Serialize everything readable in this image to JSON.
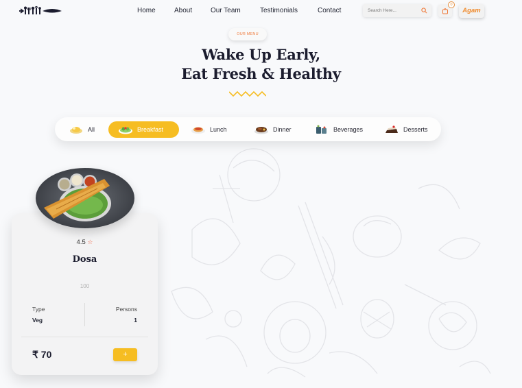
{
  "nav": {
    "items": [
      {
        "label": "Home"
      },
      {
        "label": "About"
      },
      {
        "label": "Our Team"
      },
      {
        "label": "Testimonials"
      },
      {
        "label": "Contact"
      }
    ]
  },
  "search": {
    "placeholder": "Search Here..."
  },
  "cart": {
    "count": "0"
  },
  "user": {
    "name": "Agam"
  },
  "hero": {
    "tag": "OUR MENU",
    "title_line1": "Wake Up Early,",
    "title_line2": "Eat Fresh & Healthy"
  },
  "tabs": [
    {
      "label": "All",
      "icon": "all-food-icon"
    },
    {
      "label": "Breakfast",
      "icon": "breakfast-icon",
      "active": true
    },
    {
      "label": "Lunch",
      "icon": "lunch-icon"
    },
    {
      "label": "Dinner",
      "icon": "dinner-icon"
    },
    {
      "label": "Beverages",
      "icon": "beverages-icon"
    },
    {
      "label": "Desserts",
      "icon": "desserts-icon"
    }
  ],
  "card": {
    "rating": "4.5",
    "name": "Dosa",
    "calories": "100",
    "type_label": "Type",
    "type_value": "Veg",
    "persons_label": "Persons",
    "persons_value": "1",
    "price": "₹ 70",
    "add_label": "+"
  },
  "colors": {
    "accent": "#f6bd22",
    "brand_orange": "#ef7b3c",
    "text_dark": "#1b1c2e",
    "background": "#f8f9fb"
  }
}
